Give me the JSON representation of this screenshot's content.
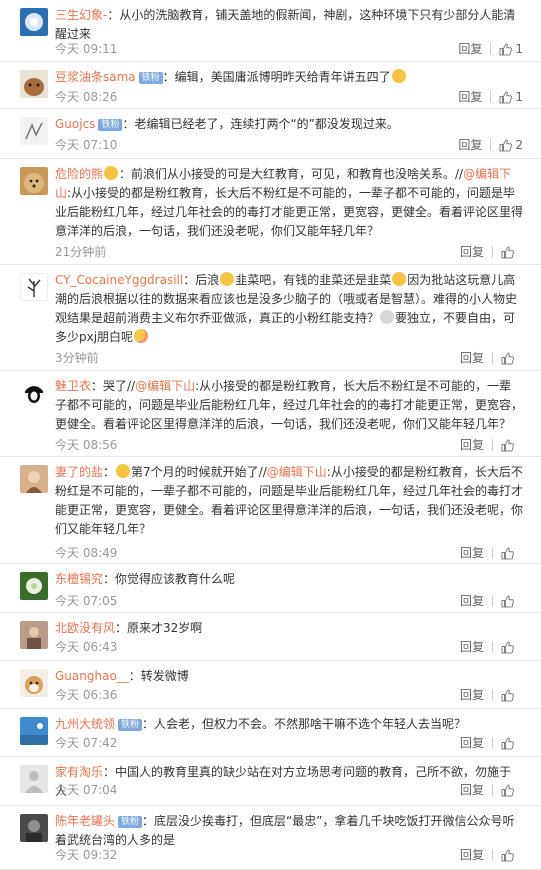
{
  "comments": [
    {
      "user": "三生幻象-",
      "vip": false,
      "avatar": "dandelion-blue",
      "segments": [
        {
          "t": "：从小的洗脑教育，铺天盖地的假新闻，神剧，这种环境下只有少部分人能清醒过来"
        }
      ],
      "time": "今天 09:11",
      "reply": "回复",
      "likes": "1"
    },
    {
      "user": "豆浆油条sama",
      "vip": true,
      "avatar": "dog-brown",
      "segments": [
        {
          "t": "：编辑，美国庸派博明昨天给青年讲五四了"
        },
        {
          "emo": "yellow"
        }
      ],
      "time": "今天 08:26",
      "reply": "回复",
      "likes": "1"
    },
    {
      "user": "Guojcs",
      "vip": true,
      "avatar": "sketch-gray",
      "segments": [
        {
          "t": "：老编辑已经老了，连续打两个“的”都没发现过来。"
        }
      ],
      "time": "今天 07:10",
      "reply": "回复",
      "likes": "2"
    },
    {
      "user": "危险的熊",
      "vip": false,
      "avatar": "dog-golden",
      "segments": [
        {
          "emo": "yellow"
        },
        {
          "t": "：前浪们从小接受的可是大红教育，可见，和教育也没啥关系。//"
        },
        {
          "at": "@编辑下山"
        },
        {
          "t": ":从小接受的都是粉红教育，长大后不粉红是不可能的，一辈子都不可能的，问题是毕业后能粉红几年，经过几年社会的的毒打才能更正常，更宽容，更健全。看着评论区里得意洋洋的后浪，一句话，我们还没老呢，你们又能年轻几年？"
        }
      ],
      "time": "21分钟前",
      "reply": "回复",
      "likes": ""
    },
    {
      "user": "CY_CocaineYggdrasill",
      "vip": false,
      "avatar": "tree-logo",
      "segments": [
        {
          "t": "：后浪"
        },
        {
          "emo": "yellow"
        },
        {
          "t": "韭菜吧，有钱的韭菜还是韭菜"
        },
        {
          "emo": "yellow"
        },
        {
          "t": "因为批站这玩意儿高潮的后浪根据以往的数据来看应该也是没多少脑子的（哦或者是智慧）。难得的小人物史观结果是超前消费主义布尔乔亚做派，真正的小粉红能支持？"
        },
        {
          "emo": "gray"
        },
        {
          "t": "要独立，不要自由，可多少pxj朋白呢"
        },
        {
          "emo": "blush"
        }
      ],
      "time": "3分钟前",
      "reply": "回复",
      "likes": ""
    },
    {
      "user": "魅卫衣",
      "vip": false,
      "avatar": "che-portrait",
      "segments": [
        {
          "t": "：哭了//"
        },
        {
          "at": "@编辑下山"
        },
        {
          "t": ":从小接受的都是粉红教育，长大后不粉红是不可能的，一辈子都不可能的，问题是毕业后能粉红几年，经过几年社会的的毒打才能更正常，更宽容，更健全。看着评论区里得意洋洋的后浪，一句话，我们还没老呢，你们又能年轻几年？"
        }
      ],
      "time": "今天 08:56",
      "reply": "回复",
      "likes": ""
    },
    {
      "user": "妻了的盐",
      "vip": false,
      "avatar": "girl-photo",
      "segments": [
        {
          "t": "："
        },
        {
          "emo": "yellow"
        },
        {
          "t": "第7个月的时候就开始了//"
        },
        {
          "at": "@编辑下山"
        },
        {
          "t": ":从小接受的都是粉红教育，长大后不粉红是不可能的，一辈子都不可能的，问题是毕业后能粉红几年，经过几年社会的毒打才能更正常，更宽容，更健全。看着评论区里得意洋洋的后浪，一句话，我们还没老呢，你们又能年轻几年？"
        }
      ],
      "time": "今天 08:49",
      "reply": "回复",
      "likes": ""
    },
    {
      "user": "东檀锡究",
      "vip": false,
      "avatar": "dandelion-green",
      "segments": [
        {
          "t": "：你觉得应该教育什么呢"
        }
      ],
      "time": "今天 07:05",
      "reply": "回复",
      "likes": ""
    },
    {
      "user": "北欧没有风",
      "vip": false,
      "avatar": "person-photo",
      "segments": [
        {
          "t": "：原来才32岁啊"
        }
      ],
      "time": "今天 06:43",
      "reply": "回复",
      "likes": ""
    },
    {
      "user": "Guanghao__",
      "vip": false,
      "avatar": "dog-shiba",
      "segments": [
        {
          "t": "：转发微博"
        }
      ],
      "time": "今天 06:36",
      "reply": "回复",
      "likes": ""
    },
    {
      "user": "九州大统领",
      "vip": true,
      "avatar": "blue-scene",
      "segments": [
        {
          "t": "：人会老，但权力不会。不然那啥干嘛不选个年轻人去当呢？"
        }
      ],
      "time": "今天 07:42",
      "reply": "回复",
      "likes": ""
    },
    {
      "user": "家有淘乐",
      "vip": false,
      "avatar": "default-gray",
      "segments": [
        {
          "t": "：中国人的教育里真的缺少站在对方立场思考问题的教育，己所不欲，勿施于人"
        }
      ],
      "time": "今天 07:04",
      "reply": "回复",
      "likes": ""
    },
    {
      "user": "陈年老罐头",
      "vip": true,
      "avatar": "dark-photo",
      "segments": [
        {
          "t": "：底层没少挨毒打，但底层“最忠”，拿着几千块吃饭打开微信公众号听着武统台湾的人多的是"
        }
      ],
      "time": "今天 09:32",
      "reply": "回复",
      "likes": ""
    }
  ],
  "ui": {
    "vip_badge": "铁粉",
    "reply_label": "回复"
  }
}
